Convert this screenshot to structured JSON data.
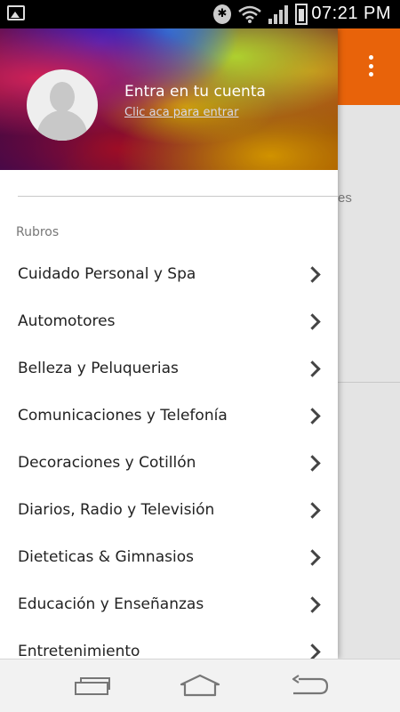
{
  "status_bar": {
    "time": "07:21 PM",
    "icons": [
      "gallery-icon",
      "bluetooth-icon",
      "wifi-icon",
      "signal-icon",
      "battery-icon"
    ],
    "bluetooth_glyph": "✱"
  },
  "background_app": {
    "appbar_color": "#e8630a",
    "partial_text": "es"
  },
  "drawer": {
    "header": {
      "title": "Entra en tu cuenta",
      "link": "Clic aca para entrar"
    },
    "section_label": "Rubros",
    "items": [
      {
        "label": "Cuidado Personal y Spa"
      },
      {
        "label": "Automotores"
      },
      {
        "label": "Belleza y Peluquerias"
      },
      {
        "label": "Comunicaciones y Telefonía"
      },
      {
        "label": "Decoraciones y Cotillón"
      },
      {
        "label": "Diarios, Radio y Televisión"
      },
      {
        "label": "Dieteticas & Gimnasios"
      },
      {
        "label": "Educación y Enseñanzas"
      },
      {
        "label": "Entretenimiento"
      }
    ]
  },
  "nav_bar": {
    "buttons": [
      "recents-button",
      "home-button",
      "back-button"
    ]
  }
}
